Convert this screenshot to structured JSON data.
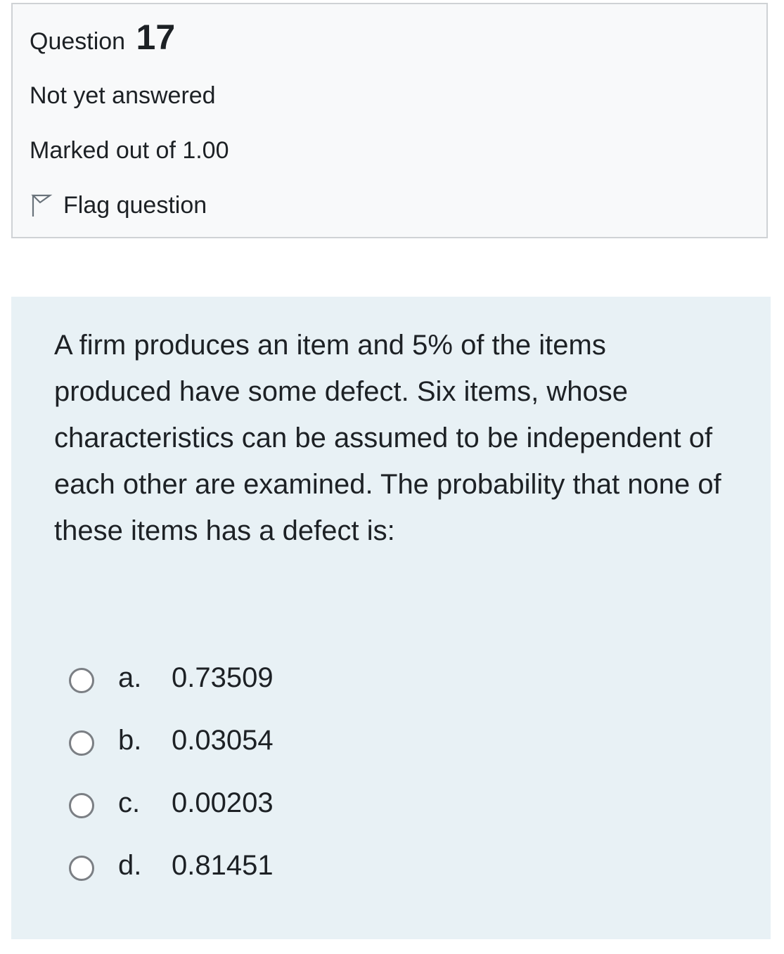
{
  "info": {
    "question_word": "Question",
    "question_number": "17",
    "state": "Not yet answered",
    "grade": "Marked out of 1.00",
    "flag_label": "Flag question"
  },
  "question": {
    "text": "A firm produces an item and 5% of the items produced have some defect. Six items, whose characteristics can be assumed to be independent of each other are examined. The probability that none of these items has a defect is:",
    "options": [
      {
        "letter": "a.",
        "value": "0.73509"
      },
      {
        "letter": "b.",
        "value": "0.03054"
      },
      {
        "letter": "c.",
        "value": "0.00203"
      },
      {
        "letter": "d.",
        "value": "0.81451"
      }
    ]
  },
  "colors": {
    "info_background": "#f8f9fa",
    "info_border": "#cfd2d5",
    "question_background": "#e8f1f5",
    "text": "#1d2125",
    "radio_border": "#7b7f84"
  },
  "icons": {
    "flag": "flag-outline-icon",
    "radio": "radio-unchecked-icon"
  }
}
